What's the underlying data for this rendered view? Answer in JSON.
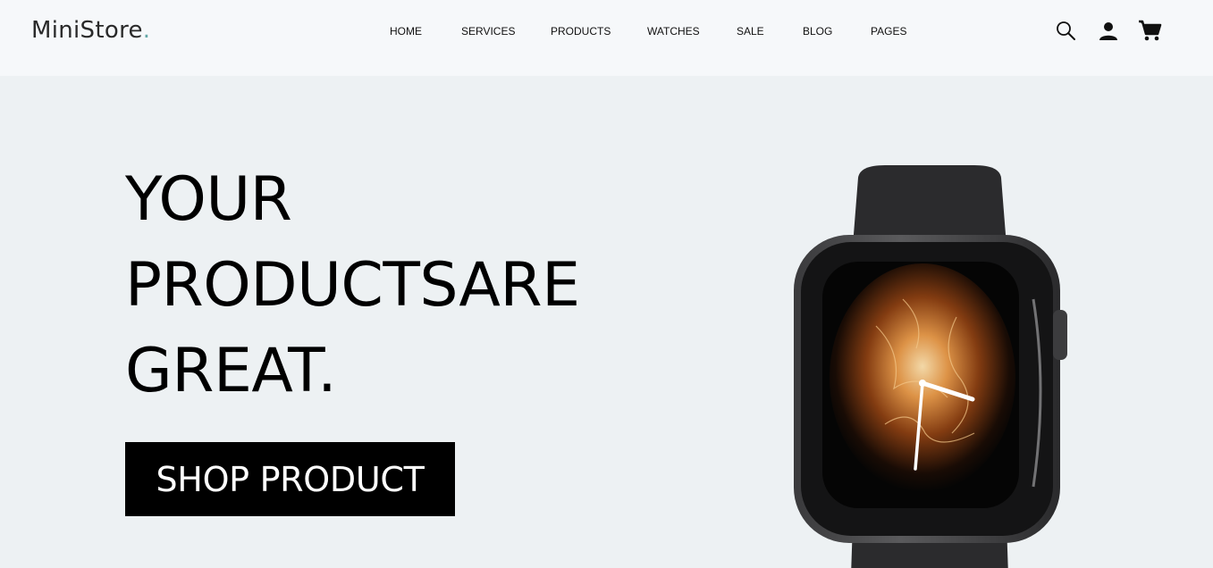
{
  "header": {
    "logo": {
      "text": "MiniStore",
      "dot": "."
    },
    "nav": [
      "HOME",
      "SERVICES",
      "PRODUCTS",
      "WATCHES",
      "SALE",
      "BLOG",
      "PAGES"
    ],
    "icons": [
      "search-icon",
      "user-icon",
      "cart-icon"
    ]
  },
  "hero": {
    "headline": [
      "YOUR",
      "PRODUCTSARE",
      "GREAT."
    ],
    "cta_label": "SHOP PRODUCT",
    "image": "smartwatch-product-image"
  },
  "colors": {
    "header_bg": "#f6f8fa",
    "hero_bg": "#edf1f3",
    "logo_dot": "#64a8a8",
    "button_bg": "#000000",
    "button_text": "#ffffff"
  }
}
